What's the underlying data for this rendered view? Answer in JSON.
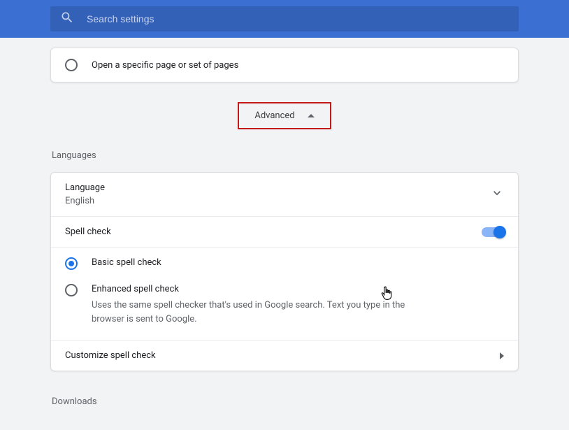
{
  "search": {
    "placeholder": "Search settings"
  },
  "startup": {
    "open_pages_label": "Open a specific page or set of pages"
  },
  "advanced": {
    "label": "Advanced"
  },
  "sections": {
    "languages_title": "Languages",
    "downloads_title": "Downloads"
  },
  "language_block": {
    "title": "Language",
    "value": "English"
  },
  "spellcheck": {
    "title": "Spell check",
    "enabled": true,
    "basic_label": "Basic spell check",
    "enhanced_label": "Enhanced spell check",
    "enhanced_desc": "Uses the same spell checker that's used in Google search. Text you type in the browser is sent to Google.",
    "customize_label": "Customize spell check"
  }
}
